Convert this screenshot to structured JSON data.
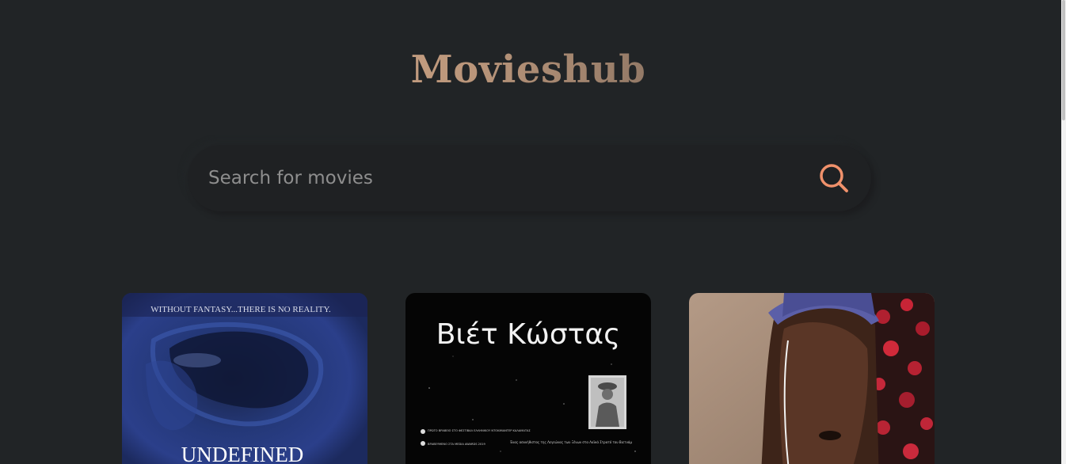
{
  "app": {
    "title": "Movieshub"
  },
  "search": {
    "placeholder": "Search for movies",
    "value": "",
    "icon": "search-icon"
  },
  "movies": [
    {
      "poster_tagline": "WITHOUT FANTASY...THERE IS NO REALITY.",
      "poster_title": "UNDEFINED"
    },
    {
      "poster_title": "Βιέτ Κώστας",
      "poster_credits_left": "ΠΡΩΤΟ ΒΡΑΒΕΙΟ ΣΤΟ ΦΕΣΤΙΒΑΛ ΕΛΛΗΝΙΚΟΥ ΝΤΟΚΙΜΑΝΤΕΡ ΚΑΛΑΜΑΤΑΣ",
      "poster_credits_left_2": "ΒΡΑΒΕΥΜΕΝΟ ΣΤΑ MEDIA AWARDS 2019",
      "poster_credits_right": "Ένας ασυνήθιστος της Λεγεώνας των Ξένων στα Λαϊκά Στρατό του Βιετνάμ"
    },
    {
      "poster_title": ""
    }
  ],
  "colors": {
    "background": "#212426",
    "accent": "#f9d3b4",
    "search_icon": "#f0916b"
  }
}
